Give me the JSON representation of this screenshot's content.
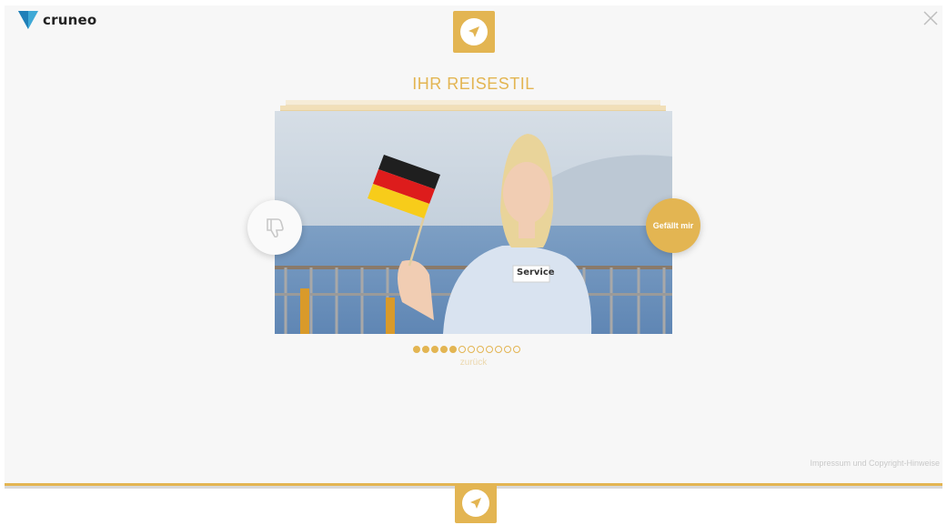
{
  "header": {
    "logo_text": "cruneo",
    "close_icon": "close-icon"
  },
  "badge": {
    "icon": "navigation-arrow-icon"
  },
  "question": {
    "title": "IHR REISESTIL"
  },
  "card": {
    "image_label": "Service"
  },
  "actions": {
    "dislike_icon": "thumbs-down-icon",
    "like_label": "Gefällt mir"
  },
  "progress": {
    "total": 12,
    "completed": 5
  },
  "navigation": {
    "back_label": "zurück"
  },
  "footer": {
    "legal_link": "Impressum und Copyright-Hinweise"
  },
  "colors": {
    "accent": "#e3b552",
    "background": "#f7f7f7"
  }
}
